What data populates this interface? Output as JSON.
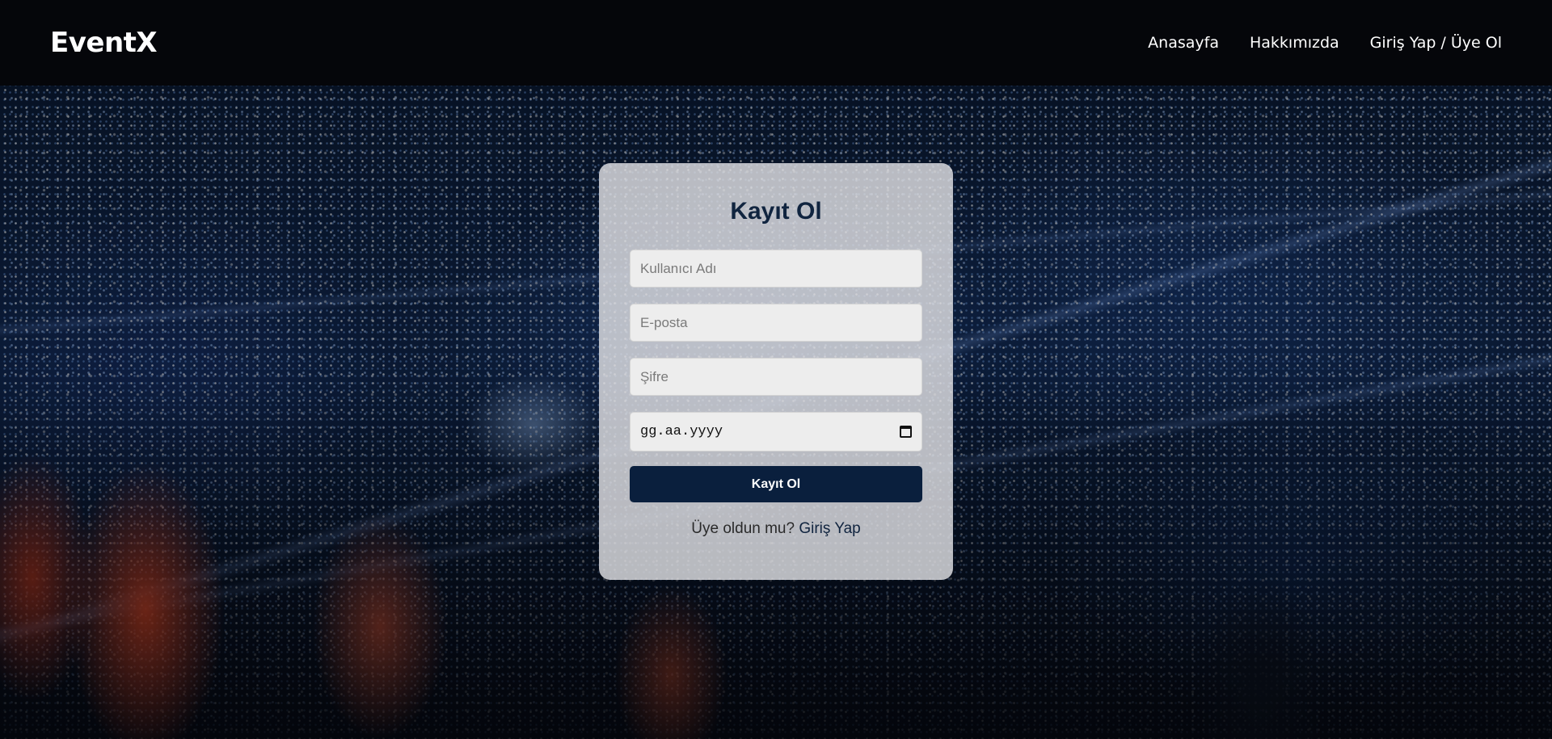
{
  "header": {
    "brand": "EventX",
    "nav": [
      {
        "label": "Anasayfa"
      },
      {
        "label": "Hakkımızda"
      },
      {
        "label": "Giriş Yap / Üye Ol"
      }
    ]
  },
  "form": {
    "title": "Kayıt Ol",
    "username_placeholder": "Kullanıcı Adı",
    "email_placeholder": "E-posta",
    "password_placeholder": "Şifre",
    "date_placeholder": "gg.aa.yyyy",
    "submit_label": "Kayıt Ol",
    "login_prompt": "Üye oldun mu?",
    "login_link": "Giriş Yap"
  },
  "colors": {
    "primary": "#0a1f3d",
    "header_bg": "#05060a",
    "card_bg": "#e1e1e4"
  },
  "icons": {
    "date": "calendar-icon"
  }
}
